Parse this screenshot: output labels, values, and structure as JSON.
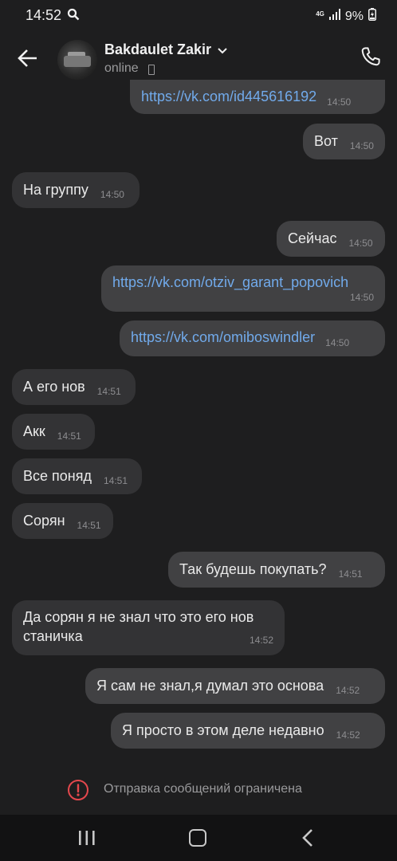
{
  "status_bar": {
    "time": "14:52",
    "network": "4G",
    "battery": "9%"
  },
  "header": {
    "contact_name": "Bakdaulet Zakir",
    "status": "online"
  },
  "messages": [
    {
      "dir": "out",
      "text": "https://vk.com/id445616192",
      "time": "14:50",
      "link": true
    },
    {
      "dir": "out",
      "text": "Вот",
      "time": "14:50"
    },
    {
      "dir": "in",
      "text": "На группу",
      "time": "14:50"
    },
    {
      "dir": "out",
      "text": "Сейчас",
      "time": "14:50"
    },
    {
      "dir": "out",
      "text": "https://vk.com/otziv_garant_popovich",
      "time": "14:50",
      "link": true
    },
    {
      "dir": "out",
      "text": "https://vk.com/omiboswindler",
      "time": "14:50",
      "link": true
    },
    {
      "dir": "in",
      "text": "А его нов",
      "time": "14:51"
    },
    {
      "dir": "in",
      "text": "Акк",
      "time": "14:51"
    },
    {
      "dir": "in",
      "text": "Все поняд",
      "time": "14:51"
    },
    {
      "dir": "in",
      "text": "Сорян",
      "time": "14:51"
    },
    {
      "dir": "out",
      "text": "Так будешь покупать?",
      "time": "14:51"
    },
    {
      "dir": "in",
      "text_line1": "Да сорян я не знал что это его нов",
      "text_line2": "станичка",
      "time": "14:52"
    },
    {
      "dir": "out",
      "text": "Я сам не знал,я думал это основа",
      "time": "14:52"
    },
    {
      "dir": "out",
      "text": "Я просто в этом деле недавно",
      "time": "14:52"
    }
  ],
  "notice": {
    "text": "Отправка сообщений ограничена",
    "icon": "alert-circle-icon",
    "icon_color": "#e5484d"
  },
  "colors": {
    "background": "#1e1e1f",
    "incoming_bubble": "#333335",
    "outgoing_bubble": "#414143",
    "link": "#71aaeb"
  }
}
